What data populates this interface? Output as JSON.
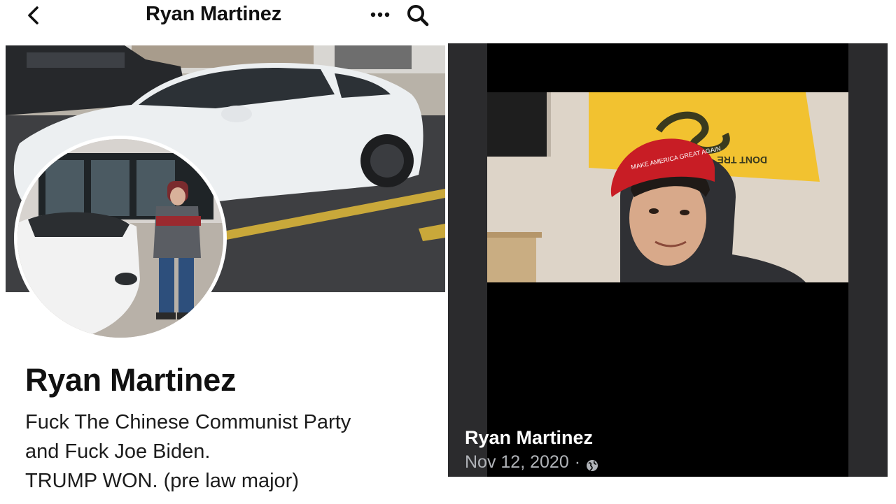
{
  "header": {
    "title": "Ryan Martinez",
    "back_icon": "chevron-left-icon",
    "more_icon": "more-dots-icon",
    "search_icon": "search-icon"
  },
  "profile": {
    "name": "Ryan Martinez",
    "bio": [
      "Fuck The Chinese Communist Party",
      "and Fuck Joe Biden.",
      "TRUMP WON. (pre law major)"
    ]
  },
  "post": {
    "author": "Ryan Martinez",
    "date": "Nov 12, 2020",
    "separator": "·",
    "privacy_icon": "globe-icon",
    "flag_text": "DONT TRE",
    "hat_text": "MAKE AMERICA GREAT AGAIN"
  },
  "colors": {
    "text_dark": "#111111",
    "meta_gray": "#b0b3b8",
    "hat_red": "#c81d25",
    "flag_yellow": "#f2c230"
  }
}
